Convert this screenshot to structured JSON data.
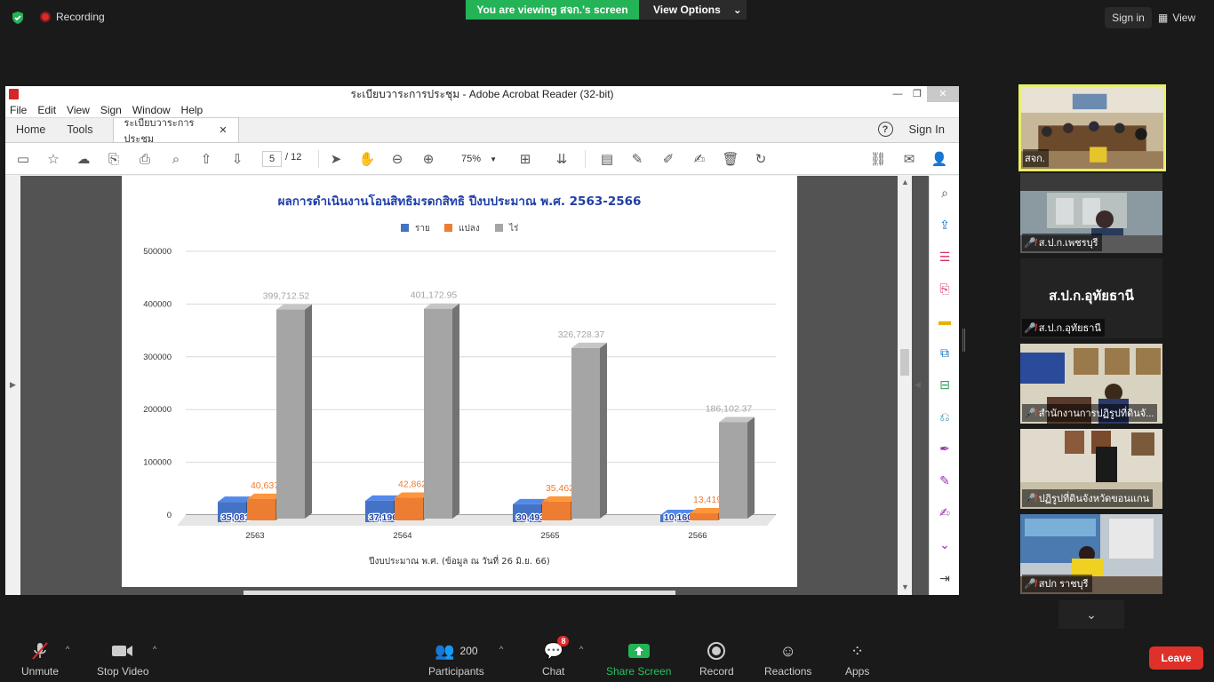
{
  "zoom": {
    "recording_label": "Recording",
    "viewing_banner": "You are viewing สจก.'s screen",
    "view_options_label": "View Options",
    "sign_in_label": "Sign in",
    "view_label": "View"
  },
  "acrobat": {
    "window_title": "ระเบียบวาระการประชุม - Adobe Acrobat Reader (32-bit)",
    "menu": [
      "File",
      "Edit",
      "View",
      "Sign",
      "Window",
      "Help"
    ],
    "tabs": {
      "home": "Home",
      "tools": "Tools",
      "doc": "ระเบียบวาระการประชุม"
    },
    "sign_in": "Sign In",
    "page_current": "5",
    "page_total": "/ 12",
    "zoom_level": "75%"
  },
  "chart_data": {
    "type": "bar",
    "title": "ผลการดำเนินงานโอนสิทธิมรดกสิทธิ ปีงบประมาณ  พ.ศ.  2563-2566",
    "xlabel": "ปีงบประมาณ พ.ศ. (ข้อมูล ณ วันที่ 26 มิ.ย. 66)",
    "ylabel": "",
    "categories": [
      "2563",
      "2564",
      "2565",
      "2566"
    ],
    "ylim": [
      0,
      500000
    ],
    "yticks": [
      "0",
      "100000",
      "200000",
      "300000",
      "400000",
      "500000"
    ],
    "legend_position": "top-center",
    "grid": true,
    "series": [
      {
        "name": "ราย",
        "color": "#4472c4",
        "values": [
          35081,
          37196,
          30493,
          10160
        ],
        "labels": [
          "35,081",
          "37,196",
          "30,493",
          "10,160"
        ]
      },
      {
        "name": "แปลง",
        "color": "#ed7d31",
        "values": [
          40637,
          42862,
          35462,
          13419
        ],
        "labels": [
          "40,637",
          "42,862",
          "35,462",
          "13,419"
        ]
      },
      {
        "name": "ไร่",
        "color": "#a5a5a5",
        "values": [
          399712.52,
          401172.95,
          326728.37,
          186102.37
        ],
        "labels": [
          "399,712.52",
          "401,172.95",
          "326,728.37",
          "186,102.37"
        ]
      }
    ]
  },
  "participants": [
    {
      "name": "สจก.",
      "muted": false,
      "active": true
    },
    {
      "name": "ส.ป.ก.เพชรบุรี",
      "muted": true
    },
    {
      "name": "ส.ป.ก.อุทัยธานี",
      "muted": true,
      "big_name": "ส.ป.ก.อุทัยธานี"
    },
    {
      "name": "สำนักงานการปฏิรูปที่ดินจั...",
      "muted": true
    },
    {
      "name": "ปฏิรูปที่ดินจังหวัดขอนแกน",
      "muted": true
    },
    {
      "name": "สปก ราชบุรี",
      "muted": true
    }
  ],
  "bottom": {
    "unmute": "Unmute",
    "stop_video": "Stop Video",
    "participants": "Participants",
    "participants_count": "200",
    "chat": "Chat",
    "chat_badge": "8",
    "share_screen": "Share Screen",
    "record": "Record",
    "reactions": "Reactions",
    "apps": "Apps",
    "leave": "Leave"
  }
}
